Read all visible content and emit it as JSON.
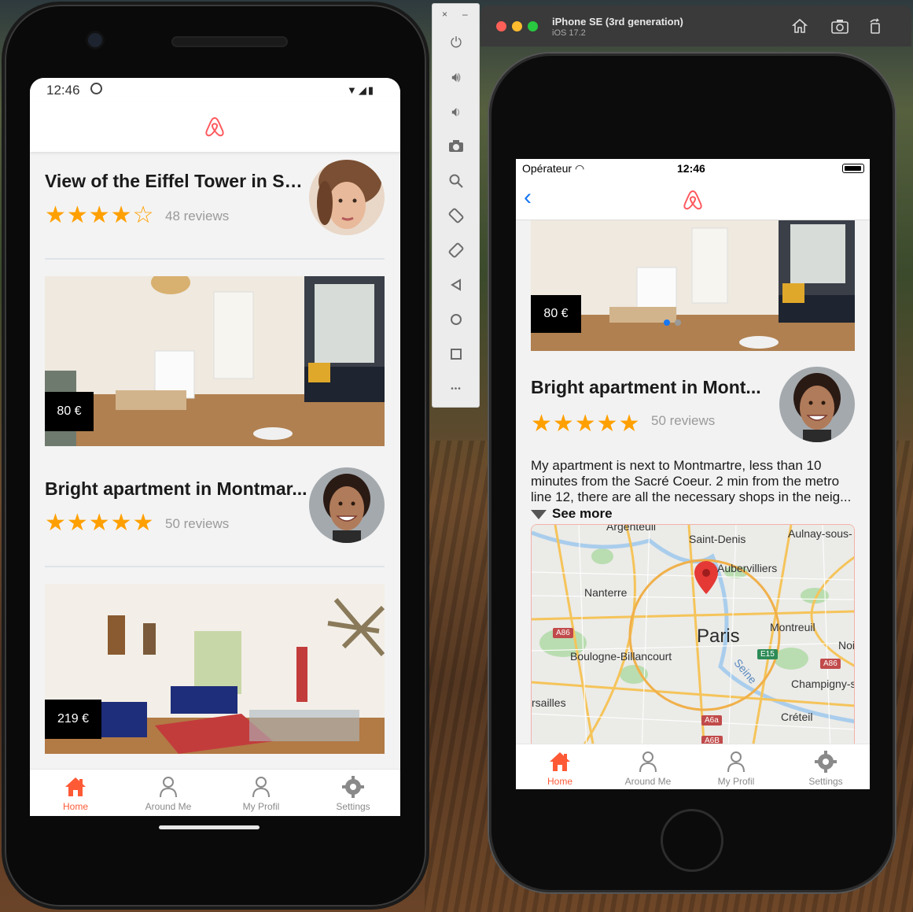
{
  "android": {
    "status_time": "12:46",
    "cards_top": {
      "title": "View of the Eiffel Tower in Sa...",
      "stars": "★★★★☆",
      "reviews": "48 reviews"
    },
    "listing1": {
      "price": "80 €",
      "title": "Bright apartment in Montmar...",
      "stars": "★★★★★",
      "reviews": "50 reviews"
    },
    "listing2": {
      "price": "219 €"
    },
    "tabs": [
      {
        "label": "Home",
        "icon": "home-icon"
      },
      {
        "label": "Around Me",
        "icon": "person-icon"
      },
      {
        "label": "My Profil",
        "icon": "person-icon"
      },
      {
        "label": "Settings",
        "icon": "gear-icon"
      }
    ]
  },
  "emulator_toolbar": {
    "close": "×",
    "minimize": "–",
    "more": "•••"
  },
  "simulator": {
    "device_name": "iPhone SE (3rd generation)",
    "os_version": "iOS 17.2"
  },
  "ios": {
    "carrier": "Opérateur",
    "status_time": "12:46",
    "price": "80 €",
    "title": "Bright apartment in Mont...",
    "stars": "★★★★★",
    "reviews": "50 reviews",
    "description": "My apartment is next to Montmartre, less than 10 minutes from the Sacré Coeur. 2 min from the metro line 12, there are all the necessary shops in the neig...",
    "see_more": "See more",
    "map_labels": {
      "argenteuil": "Argenteuil",
      "saint_denis": "Saint-Denis",
      "aulnay": "Aulnay-sous-",
      "aubervilliers": "Aubervilliers",
      "nanterre": "Nanterre",
      "paris": "Paris",
      "montreuil": "Montreuil",
      "boulogne": "Boulogne-Billancourt",
      "noisy": "Noi",
      "seine": "Seine",
      "champigny": "Champigny-s",
      "versailles": "rsailles",
      "creteil": "Créteil",
      "a86_left": "A86",
      "a86_right": "A86",
      "e15": "E15",
      "a6a": "A6a",
      "a6b": "A6B"
    },
    "tabs": [
      {
        "label": "Home",
        "icon": "home-icon"
      },
      {
        "label": "Around Me",
        "icon": "person-icon"
      },
      {
        "label": "My Profil",
        "icon": "person-icon"
      },
      {
        "label": "Settings",
        "icon": "gear-icon"
      }
    ]
  },
  "colors": {
    "brand": "#ff5a5f",
    "active_tab": "#ff5a36",
    "star": "#ffa000",
    "ios_link": "#1877f2"
  }
}
